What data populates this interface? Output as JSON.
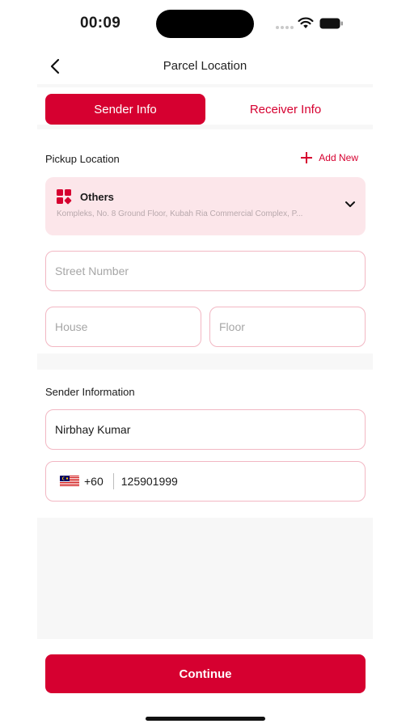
{
  "status_bar": {
    "time": "00:09"
  },
  "header": {
    "title": "Parcel Location"
  },
  "tabs": [
    {
      "label": "Sender Info",
      "active": true
    },
    {
      "label": "Receiver Info",
      "active": false
    }
  ],
  "pickup": {
    "section_label": "Pickup Location",
    "add_new_label": "Add New",
    "location": {
      "type": "Others",
      "address": "Kompleks, No. 8 Ground Floor, Kubah Ria Commercial Complex, P..."
    }
  },
  "address_fields": {
    "street_placeholder": "Street Number",
    "house_placeholder": "House",
    "floor_placeholder": "Floor"
  },
  "sender": {
    "section_label": "Sender Information",
    "name_value": "Nirbhay Kumar",
    "dial_code": "+60",
    "phone_value": "125901999",
    "flag": "malaysia-flag-icon"
  },
  "actions": {
    "continue_label": "Continue"
  },
  "colors": {
    "primary": "#d60030",
    "card_bg": "#fce6ea",
    "input_border": "#f2b7c3",
    "panel_gray": "#f7f7f7"
  }
}
